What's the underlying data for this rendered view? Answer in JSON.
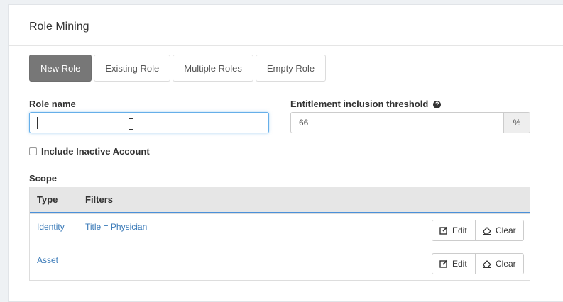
{
  "panel": {
    "title": "Role Mining"
  },
  "tabs": [
    {
      "label": "New Role",
      "active": true
    },
    {
      "label": "Existing Role",
      "active": false
    },
    {
      "label": "Multiple Roles",
      "active": false
    },
    {
      "label": "Empty Role",
      "active": false
    }
  ],
  "form": {
    "role_name_label": "Role name",
    "role_name_value": "",
    "threshold_label": "Entitlement inclusion threshold",
    "threshold_value": "66",
    "threshold_unit": "%",
    "help_icon": "question-circle-icon",
    "include_inactive_label": "Include Inactive Account",
    "include_inactive_checked": false
  },
  "scope": {
    "label": "Scope",
    "columns": [
      "Type",
      "Filters"
    ],
    "rows": [
      {
        "type": "Identity",
        "filter": "Title = Physician"
      },
      {
        "type": "Asset",
        "filter": ""
      }
    ],
    "edit_label": "Edit",
    "clear_label": "Clear",
    "edit_icon": "edit-icon",
    "clear_icon": "eraser-icon"
  },
  "colors": {
    "active_tab": "#777777",
    "link": "#3a7ab8",
    "focus_border": "#66afe9",
    "table_header_border": "#4a90d9"
  }
}
